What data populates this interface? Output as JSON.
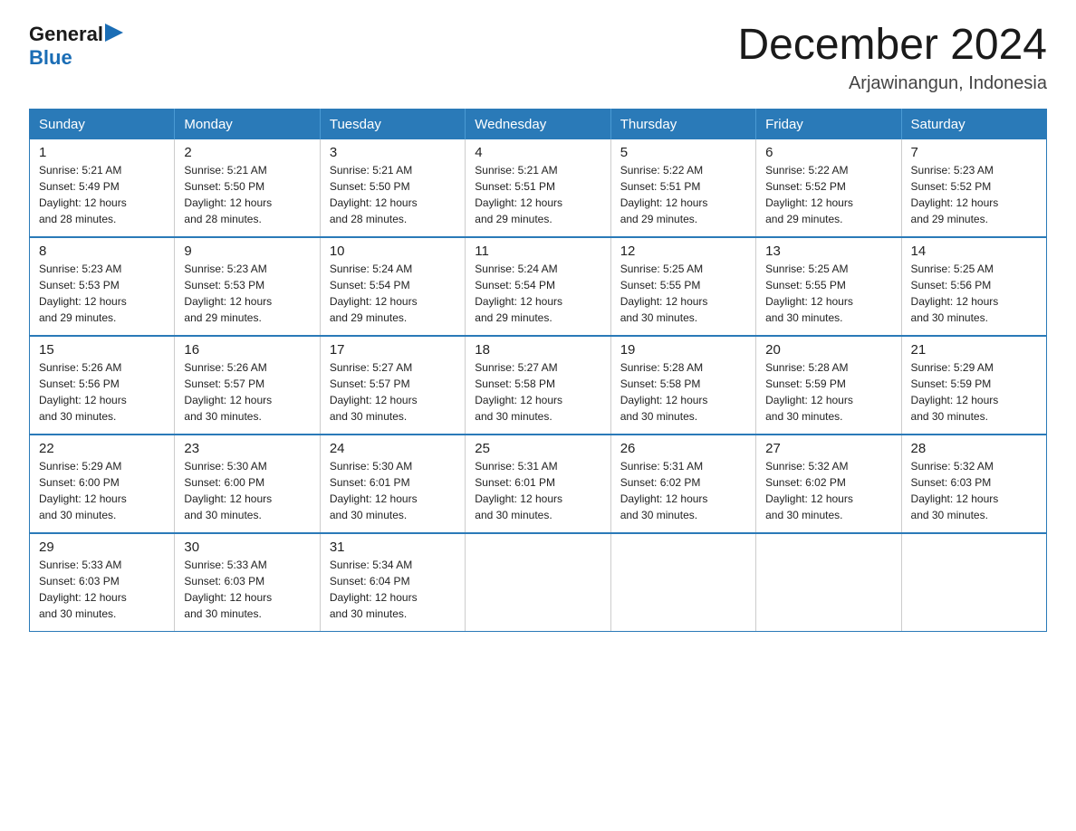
{
  "logo": {
    "text_general": "General",
    "text_blue": "Blue",
    "arrow": "▶"
  },
  "title": "December 2024",
  "location": "Arjawinangun, Indonesia",
  "days_of_week": [
    "Sunday",
    "Monday",
    "Tuesday",
    "Wednesday",
    "Thursday",
    "Friday",
    "Saturday"
  ],
  "weeks": [
    [
      {
        "day": "1",
        "sunrise": "5:21 AM",
        "sunset": "5:49 PM",
        "daylight": "12 hours and 28 minutes."
      },
      {
        "day": "2",
        "sunrise": "5:21 AM",
        "sunset": "5:50 PM",
        "daylight": "12 hours and 28 minutes."
      },
      {
        "day": "3",
        "sunrise": "5:21 AM",
        "sunset": "5:50 PM",
        "daylight": "12 hours and 28 minutes."
      },
      {
        "day": "4",
        "sunrise": "5:21 AM",
        "sunset": "5:51 PM",
        "daylight": "12 hours and 29 minutes."
      },
      {
        "day": "5",
        "sunrise": "5:22 AM",
        "sunset": "5:51 PM",
        "daylight": "12 hours and 29 minutes."
      },
      {
        "day": "6",
        "sunrise": "5:22 AM",
        "sunset": "5:52 PM",
        "daylight": "12 hours and 29 minutes."
      },
      {
        "day": "7",
        "sunrise": "5:23 AM",
        "sunset": "5:52 PM",
        "daylight": "12 hours and 29 minutes."
      }
    ],
    [
      {
        "day": "8",
        "sunrise": "5:23 AM",
        "sunset": "5:53 PM",
        "daylight": "12 hours and 29 minutes."
      },
      {
        "day": "9",
        "sunrise": "5:23 AM",
        "sunset": "5:53 PM",
        "daylight": "12 hours and 29 minutes."
      },
      {
        "day": "10",
        "sunrise": "5:24 AM",
        "sunset": "5:54 PM",
        "daylight": "12 hours and 29 minutes."
      },
      {
        "day": "11",
        "sunrise": "5:24 AM",
        "sunset": "5:54 PM",
        "daylight": "12 hours and 29 minutes."
      },
      {
        "day": "12",
        "sunrise": "5:25 AM",
        "sunset": "5:55 PM",
        "daylight": "12 hours and 30 minutes."
      },
      {
        "day": "13",
        "sunrise": "5:25 AM",
        "sunset": "5:55 PM",
        "daylight": "12 hours and 30 minutes."
      },
      {
        "day": "14",
        "sunrise": "5:25 AM",
        "sunset": "5:56 PM",
        "daylight": "12 hours and 30 minutes."
      }
    ],
    [
      {
        "day": "15",
        "sunrise": "5:26 AM",
        "sunset": "5:56 PM",
        "daylight": "12 hours and 30 minutes."
      },
      {
        "day": "16",
        "sunrise": "5:26 AM",
        "sunset": "5:57 PM",
        "daylight": "12 hours and 30 minutes."
      },
      {
        "day": "17",
        "sunrise": "5:27 AM",
        "sunset": "5:57 PM",
        "daylight": "12 hours and 30 minutes."
      },
      {
        "day": "18",
        "sunrise": "5:27 AM",
        "sunset": "5:58 PM",
        "daylight": "12 hours and 30 minutes."
      },
      {
        "day": "19",
        "sunrise": "5:28 AM",
        "sunset": "5:58 PM",
        "daylight": "12 hours and 30 minutes."
      },
      {
        "day": "20",
        "sunrise": "5:28 AM",
        "sunset": "5:59 PM",
        "daylight": "12 hours and 30 minutes."
      },
      {
        "day": "21",
        "sunrise": "5:29 AM",
        "sunset": "5:59 PM",
        "daylight": "12 hours and 30 minutes."
      }
    ],
    [
      {
        "day": "22",
        "sunrise": "5:29 AM",
        "sunset": "6:00 PM",
        "daylight": "12 hours and 30 minutes."
      },
      {
        "day": "23",
        "sunrise": "5:30 AM",
        "sunset": "6:00 PM",
        "daylight": "12 hours and 30 minutes."
      },
      {
        "day": "24",
        "sunrise": "5:30 AM",
        "sunset": "6:01 PM",
        "daylight": "12 hours and 30 minutes."
      },
      {
        "day": "25",
        "sunrise": "5:31 AM",
        "sunset": "6:01 PM",
        "daylight": "12 hours and 30 minutes."
      },
      {
        "day": "26",
        "sunrise": "5:31 AM",
        "sunset": "6:02 PM",
        "daylight": "12 hours and 30 minutes."
      },
      {
        "day": "27",
        "sunrise": "5:32 AM",
        "sunset": "6:02 PM",
        "daylight": "12 hours and 30 minutes."
      },
      {
        "day": "28",
        "sunrise": "5:32 AM",
        "sunset": "6:03 PM",
        "daylight": "12 hours and 30 minutes."
      }
    ],
    [
      {
        "day": "29",
        "sunrise": "5:33 AM",
        "sunset": "6:03 PM",
        "daylight": "12 hours and 30 minutes."
      },
      {
        "day": "30",
        "sunrise": "5:33 AM",
        "sunset": "6:03 PM",
        "daylight": "12 hours and 30 minutes."
      },
      {
        "day": "31",
        "sunrise": "5:34 AM",
        "sunset": "6:04 PM",
        "daylight": "12 hours and 30 minutes."
      },
      null,
      null,
      null,
      null
    ]
  ],
  "labels": {
    "sunrise": "Sunrise:",
    "sunset": "Sunset:",
    "daylight": "Daylight:"
  }
}
